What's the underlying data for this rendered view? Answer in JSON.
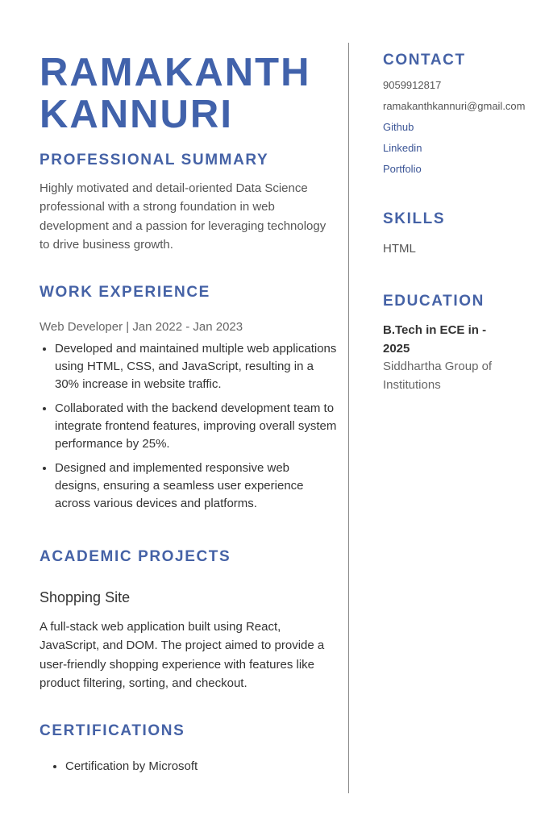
{
  "name": {
    "line1": "RAMAKANTH",
    "line2": "KANNURI"
  },
  "summary": {
    "heading": "PROFESSIONAL SUMMARY",
    "text": "Highly motivated and detail-oriented Data Science professional with a strong foundation in web development and a passion for leveraging technology to drive business growth."
  },
  "work": {
    "heading": "WORK EXPERIENCE",
    "role": "Web Developer | Jan 2022 - Jan 2023",
    "bullets": [
      "Developed and maintained multiple web applications using HTML, CSS, and JavaScript, resulting in a 30% increase in website traffic.",
      "Collaborated with the backend development team to integrate frontend features, improving overall system performance by 25%.",
      "Designed and implemented responsive web designs, ensuring a seamless user experience across various devices and platforms."
    ]
  },
  "projects": {
    "heading": "ACADEMIC PROJECTS",
    "title": "Shopping Site",
    "text": "A full-stack web application built using React, JavaScript, and DOM. The project aimed to provide a user-friendly shopping experience with features like product filtering, sorting, and checkout."
  },
  "certifications": {
    "heading": "CERTIFICATIONS",
    "items": [
      "Certification by Microsoft"
    ]
  },
  "contact": {
    "heading": "CONTACT",
    "phone": "9059912817",
    "email": "ramakanthkannuri@gmail.com",
    "github": "Github",
    "linkedin": "Linkedin",
    "portfolio": "Portfolio"
  },
  "skills": {
    "heading": "SKILLS",
    "items": [
      "HTML"
    ]
  },
  "education": {
    "heading": "EDUCATION",
    "degree": "B.Tech in ECE in - 2025",
    "school": "Siddhartha Group of Institutions"
  },
  "colors": {
    "accent": "#4562a6",
    "text": "#555555",
    "divider": "#888888"
  }
}
